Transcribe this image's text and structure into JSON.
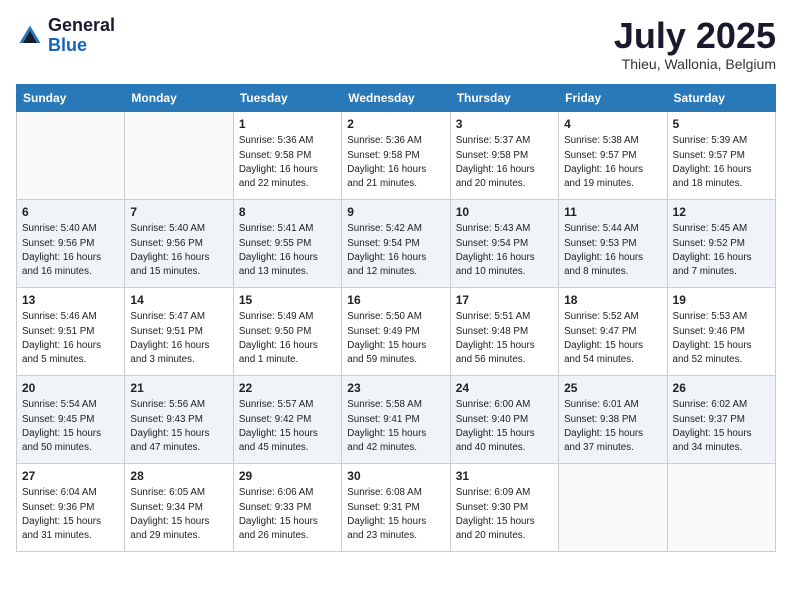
{
  "logo": {
    "general": "General",
    "blue": "Blue"
  },
  "title": "July 2025",
  "subtitle": "Thieu, Wallonia, Belgium",
  "days_of_week": [
    "Sunday",
    "Monday",
    "Tuesday",
    "Wednesday",
    "Thursday",
    "Friday",
    "Saturday"
  ],
  "weeks": [
    [
      {
        "day": "",
        "info": ""
      },
      {
        "day": "",
        "info": ""
      },
      {
        "day": "1",
        "info": "Sunrise: 5:36 AM\nSunset: 9:58 PM\nDaylight: 16 hours\nand 22 minutes."
      },
      {
        "day": "2",
        "info": "Sunrise: 5:36 AM\nSunset: 9:58 PM\nDaylight: 16 hours\nand 21 minutes."
      },
      {
        "day": "3",
        "info": "Sunrise: 5:37 AM\nSunset: 9:58 PM\nDaylight: 16 hours\nand 20 minutes."
      },
      {
        "day": "4",
        "info": "Sunrise: 5:38 AM\nSunset: 9:57 PM\nDaylight: 16 hours\nand 19 minutes."
      },
      {
        "day": "5",
        "info": "Sunrise: 5:39 AM\nSunset: 9:57 PM\nDaylight: 16 hours\nand 18 minutes."
      }
    ],
    [
      {
        "day": "6",
        "info": "Sunrise: 5:40 AM\nSunset: 9:56 PM\nDaylight: 16 hours\nand 16 minutes."
      },
      {
        "day": "7",
        "info": "Sunrise: 5:40 AM\nSunset: 9:56 PM\nDaylight: 16 hours\nand 15 minutes."
      },
      {
        "day": "8",
        "info": "Sunrise: 5:41 AM\nSunset: 9:55 PM\nDaylight: 16 hours\nand 13 minutes."
      },
      {
        "day": "9",
        "info": "Sunrise: 5:42 AM\nSunset: 9:54 PM\nDaylight: 16 hours\nand 12 minutes."
      },
      {
        "day": "10",
        "info": "Sunrise: 5:43 AM\nSunset: 9:54 PM\nDaylight: 16 hours\nand 10 minutes."
      },
      {
        "day": "11",
        "info": "Sunrise: 5:44 AM\nSunset: 9:53 PM\nDaylight: 16 hours\nand 8 minutes."
      },
      {
        "day": "12",
        "info": "Sunrise: 5:45 AM\nSunset: 9:52 PM\nDaylight: 16 hours\nand 7 minutes."
      }
    ],
    [
      {
        "day": "13",
        "info": "Sunrise: 5:46 AM\nSunset: 9:51 PM\nDaylight: 16 hours\nand 5 minutes."
      },
      {
        "day": "14",
        "info": "Sunrise: 5:47 AM\nSunset: 9:51 PM\nDaylight: 16 hours\nand 3 minutes."
      },
      {
        "day": "15",
        "info": "Sunrise: 5:49 AM\nSunset: 9:50 PM\nDaylight: 16 hours\nand 1 minute."
      },
      {
        "day": "16",
        "info": "Sunrise: 5:50 AM\nSunset: 9:49 PM\nDaylight: 15 hours\nand 59 minutes."
      },
      {
        "day": "17",
        "info": "Sunrise: 5:51 AM\nSunset: 9:48 PM\nDaylight: 15 hours\nand 56 minutes."
      },
      {
        "day": "18",
        "info": "Sunrise: 5:52 AM\nSunset: 9:47 PM\nDaylight: 15 hours\nand 54 minutes."
      },
      {
        "day": "19",
        "info": "Sunrise: 5:53 AM\nSunset: 9:46 PM\nDaylight: 15 hours\nand 52 minutes."
      }
    ],
    [
      {
        "day": "20",
        "info": "Sunrise: 5:54 AM\nSunset: 9:45 PM\nDaylight: 15 hours\nand 50 minutes."
      },
      {
        "day": "21",
        "info": "Sunrise: 5:56 AM\nSunset: 9:43 PM\nDaylight: 15 hours\nand 47 minutes."
      },
      {
        "day": "22",
        "info": "Sunrise: 5:57 AM\nSunset: 9:42 PM\nDaylight: 15 hours\nand 45 minutes."
      },
      {
        "day": "23",
        "info": "Sunrise: 5:58 AM\nSunset: 9:41 PM\nDaylight: 15 hours\nand 42 minutes."
      },
      {
        "day": "24",
        "info": "Sunrise: 6:00 AM\nSunset: 9:40 PM\nDaylight: 15 hours\nand 40 minutes."
      },
      {
        "day": "25",
        "info": "Sunrise: 6:01 AM\nSunset: 9:38 PM\nDaylight: 15 hours\nand 37 minutes."
      },
      {
        "day": "26",
        "info": "Sunrise: 6:02 AM\nSunset: 9:37 PM\nDaylight: 15 hours\nand 34 minutes."
      }
    ],
    [
      {
        "day": "27",
        "info": "Sunrise: 6:04 AM\nSunset: 9:36 PM\nDaylight: 15 hours\nand 31 minutes."
      },
      {
        "day": "28",
        "info": "Sunrise: 6:05 AM\nSunset: 9:34 PM\nDaylight: 15 hours\nand 29 minutes."
      },
      {
        "day": "29",
        "info": "Sunrise: 6:06 AM\nSunset: 9:33 PM\nDaylight: 15 hours\nand 26 minutes."
      },
      {
        "day": "30",
        "info": "Sunrise: 6:08 AM\nSunset: 9:31 PM\nDaylight: 15 hours\nand 23 minutes."
      },
      {
        "day": "31",
        "info": "Sunrise: 6:09 AM\nSunset: 9:30 PM\nDaylight: 15 hours\nand 20 minutes."
      },
      {
        "day": "",
        "info": ""
      },
      {
        "day": "",
        "info": ""
      }
    ]
  ]
}
